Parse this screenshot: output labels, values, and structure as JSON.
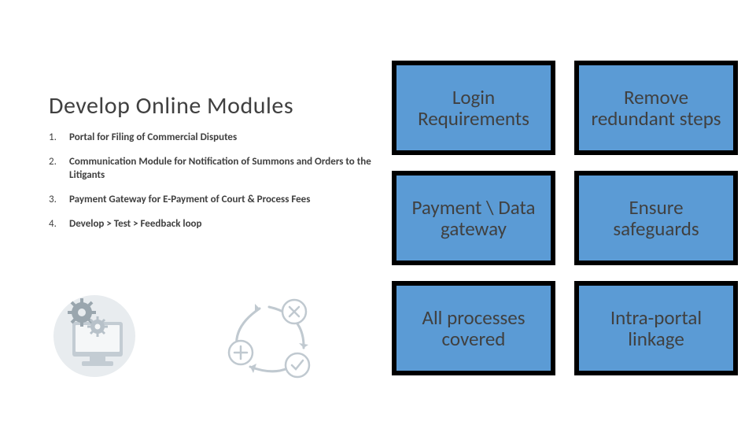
{
  "heading": "Develop Online Modules",
  "list_items": [
    "Portal for Filing of Commercial Disputes",
    "Communication Module for Notification of Summons and Orders to the Litigants",
    "Payment Gateway for E-Payment of Court & Process Fees",
    "Develop > Test > Feedback loop"
  ],
  "tiles": [
    "Login Requirements",
    "Remove redundant steps",
    "Payment \\ Data gateway",
    "Ensure safeguards",
    "All processes covered",
    "Intra-portal linkage"
  ],
  "colors": {
    "tile_fill": "#5b9bd5",
    "tile_border": "#000000",
    "text": "#404040",
    "icon": "#a9b7c0"
  }
}
